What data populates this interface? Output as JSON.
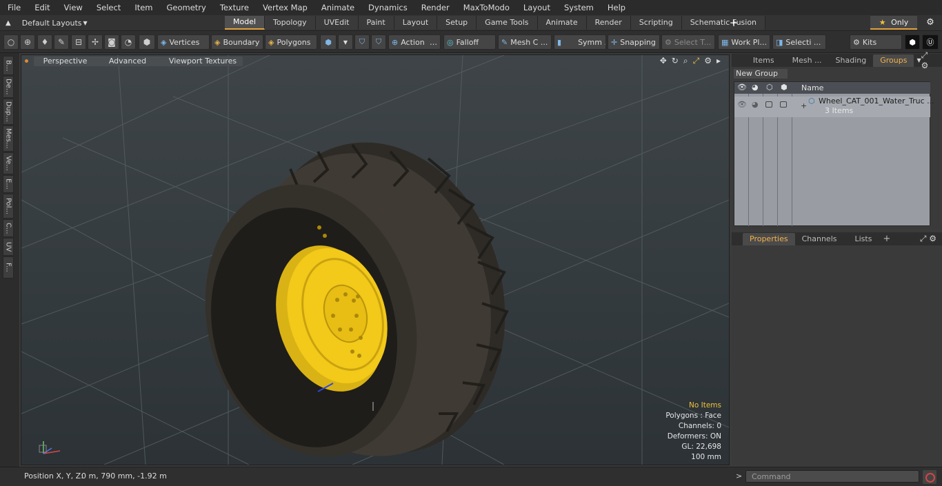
{
  "menu": [
    "File",
    "Edit",
    "View",
    "Select",
    "Item",
    "Geometry",
    "Texture",
    "Vertex Map",
    "Animate",
    "Dynamics",
    "Render",
    "MaxToModo",
    "Layout",
    "System",
    "Help"
  ],
  "layout_selector": "Default Layouts",
  "tabs": [
    {
      "label": "Model",
      "active": true
    },
    {
      "label": "Topology"
    },
    {
      "label": "UVEdit"
    },
    {
      "label": "Paint"
    },
    {
      "label": "Layout"
    },
    {
      "label": "Setup"
    },
    {
      "label": "Game Tools"
    },
    {
      "label": "Animate"
    },
    {
      "label": "Render"
    },
    {
      "label": "Scripting"
    },
    {
      "label": "Schematic Fusion"
    }
  ],
  "only_label": "Only",
  "toolbar": {
    "vertices": "Vertices",
    "boundary": "Boundary",
    "polygons": "Polygons",
    "action": "Action",
    "falloff": "Falloff",
    "mesh": "Mesh C ...",
    "symm": "Symm ...",
    "snapping": "Snapping",
    "select_t": "Select T...",
    "work_pl": "Work Pl...",
    "selecti": "Selecti ...",
    "kits": "Kits"
  },
  "left_tabs": [
    "B...",
    "De...",
    "Dup...",
    "Mes...",
    "Ve...",
    "E...",
    "Pol...",
    "C...",
    "UV",
    "F..."
  ],
  "viewport": {
    "perspective": "Perspective",
    "advanced": "Advanced",
    "textures": "Viewport Textures",
    "stats": {
      "no_items": "No Items",
      "polygons": "Polygons : Face",
      "channels": "Channels: 0",
      "deformers": "Deformers: ON",
      "gl": "GL: 22,698",
      "unit": "100 mm"
    }
  },
  "right_tabs": [
    "Items",
    "Mesh ...",
    "Shading",
    "Groups"
  ],
  "new_group": "New Group",
  "group_header": "Name",
  "group_item": {
    "name": "Wheel_CAT_001_Water_Truc ...",
    "count": "3 Items"
  },
  "props_tabs": [
    "Properties",
    "Channels",
    "Lists"
  ],
  "status": {
    "position_label": "Position X, Y, Z:",
    "position_value": "0 m, 790 mm, -1.92 m"
  },
  "command_placeholder": "Command",
  "colors": {
    "accent": "#e3a13a",
    "rim_yellow": "#f3c91a",
    "tire": "#3a3630"
  }
}
